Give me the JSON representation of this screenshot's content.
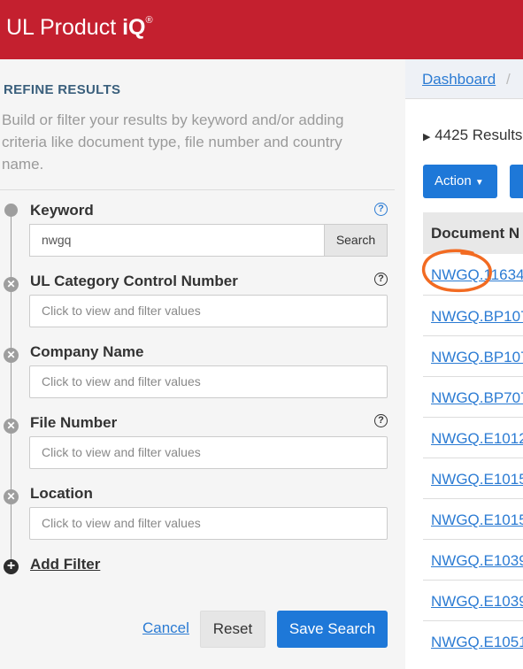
{
  "app": {
    "brand_prefix": "UL Product ",
    "brand_bold": "iQ",
    "brand_mark": "®"
  },
  "refine": {
    "title": "REFINE RESULTS",
    "description": "Build or filter your results by keyword and/or adding criteria like document type, file number and country name."
  },
  "filters": {
    "keyword": {
      "label": "Keyword",
      "value": "nwgq",
      "search_label": "Search"
    },
    "ul_ccn": {
      "label": "UL Category Control Number",
      "placeholder": "Click to view and filter values"
    },
    "company": {
      "label": "Company Name",
      "placeholder": "Click to view and filter values"
    },
    "file_number": {
      "label": "File Number",
      "placeholder": "Click to view and filter values"
    },
    "location": {
      "label": "Location",
      "placeholder": "Click to view and filter values"
    },
    "add_filter": "Add Filter"
  },
  "actions": {
    "cancel": "Cancel",
    "reset": "Reset",
    "save_search": "Save Search"
  },
  "main": {
    "breadcrumb": "Dashboard",
    "breadcrumb_sep": "/",
    "results": "4425 Results :",
    "action_label": "Action",
    "column_header": "Document N",
    "rows": [
      "NWGQ.11634",
      "NWGQ.BP107",
      "NWGQ.BP107",
      "NWGQ.BP707",
      "NWGQ.E1012",
      "NWGQ.E1015",
      "NWGQ.E1015",
      "NWGQ.E1039",
      "NWGQ.E1039",
      "NWGQ.E1051"
    ]
  },
  "colors": {
    "header": "#c4202f",
    "primary": "#1e78d8",
    "annotation": "#f26b22"
  }
}
